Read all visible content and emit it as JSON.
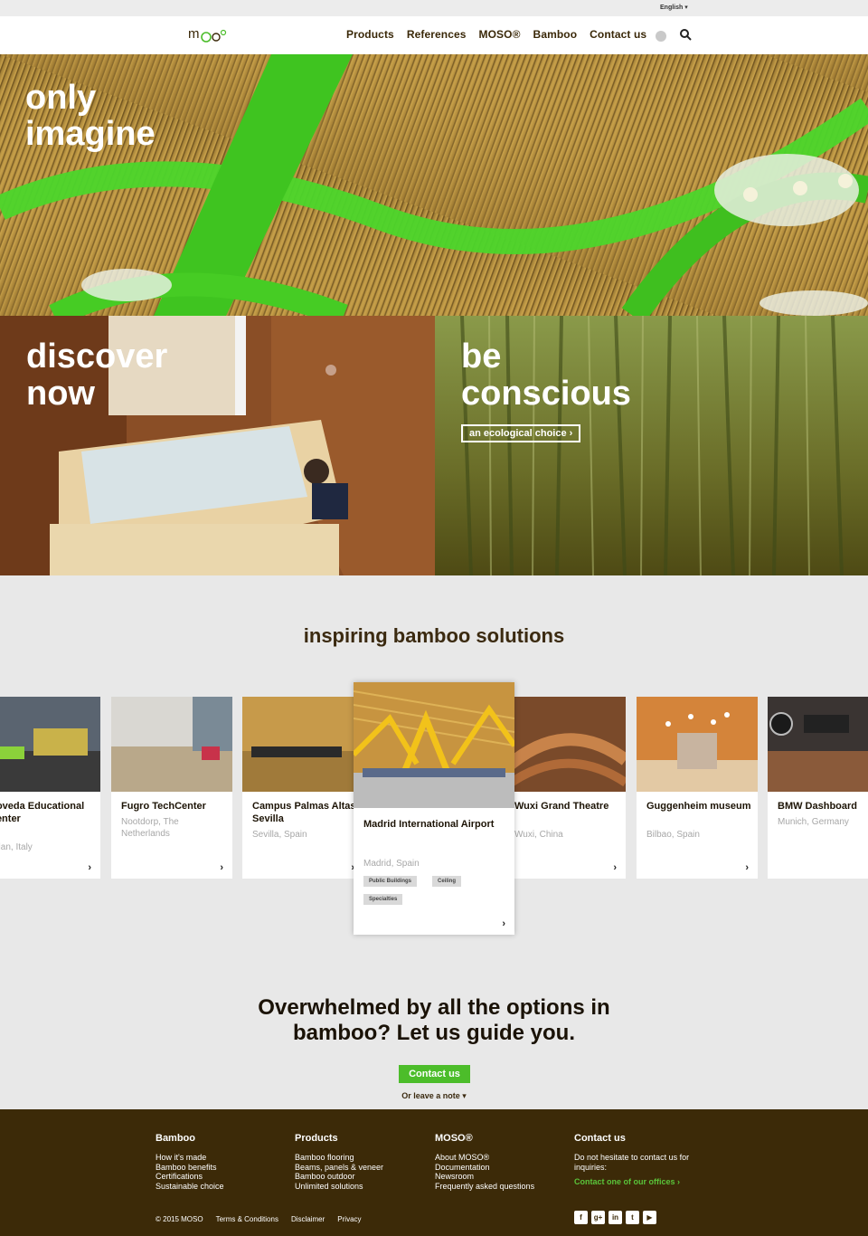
{
  "language": {
    "label": "English ▾"
  },
  "header": {
    "logo_text": "moso",
    "nav": [
      "Products",
      "References",
      "MOSO®",
      "Bamboo",
      "Contact us"
    ]
  },
  "hero": {
    "line1": "only",
    "line2": "imagine"
  },
  "panels": {
    "left": {
      "line1": "discover",
      "line2": "now"
    },
    "right": {
      "line1": "be",
      "line2": "conscious",
      "button": "an ecological choice ›"
    }
  },
  "inspiring": {
    "title": "inspiring bamboo solutions",
    "cards": [
      {
        "name": "Roveda Educational Center",
        "location": "Milan, Italy",
        "arrow": "›"
      },
      {
        "name": "Fugro TechCenter",
        "location": "Nootdorp, The Netherlands",
        "arrow": "›"
      },
      {
        "name": "Campus Palmas Altas Sevilla",
        "location": "Sevilla, Spain",
        "arrow": "›"
      },
      {
        "name": "Wuxi Grand Theatre",
        "location": "Wuxi, China",
        "arrow": "›"
      },
      {
        "name": "Guggenheim museum",
        "location": "Bilbao, Spain",
        "arrow": "›"
      },
      {
        "name": "BMW Dashboard",
        "location": "Munich, Germany",
        "arrow": "›"
      }
    ],
    "featured": {
      "name": "Madrid International Airport",
      "location": "Madrid, Spain",
      "tags": [
        "Public Buildings",
        "Ceiling",
        "Specialties"
      ],
      "arrow": "›"
    }
  },
  "cta": {
    "title_line1": "Overwhelmed by all the options in",
    "title_line2": "bamboo? Let us guide you.",
    "button": "Contact us",
    "note": "Or leave a note ▾"
  },
  "footer": {
    "columns": [
      {
        "title": "Bamboo",
        "links": [
          "How it's made",
          "Bamboo benefits",
          "Certifications",
          "Sustainable choice"
        ]
      },
      {
        "title": "Products",
        "links": [
          "Bamboo flooring",
          "Beams, panels & veneer",
          "Bamboo outdoor",
          "Unlimited solutions"
        ]
      },
      {
        "title": "MOSO®",
        "links": [
          "About MOSO®",
          "Documentation",
          "Newsroom",
          "Frequently asked questions"
        ]
      },
      {
        "title": "Contact us",
        "text": "Do not hesitate to contact us for inquiries:",
        "link": "Contact one of our offices ›"
      }
    ],
    "copyright": "© 2015 MOSO",
    "bottom_links": [
      "Terms & Conditions",
      "Disclaimer",
      "Privacy"
    ],
    "social": [
      {
        "icon": "facebook-icon",
        "glyph": "f"
      },
      {
        "icon": "google-plus-icon",
        "glyph": "g+"
      },
      {
        "icon": "linkedin-icon",
        "glyph": "in"
      },
      {
        "icon": "twitter-icon",
        "glyph": "t"
      },
      {
        "icon": "youtube-icon",
        "glyph": "▶"
      }
    ]
  },
  "colors": {
    "brand_green": "#4cbd2a",
    "footer_brown": "#3c2a08",
    "heading_brown": "#3b2a10"
  }
}
